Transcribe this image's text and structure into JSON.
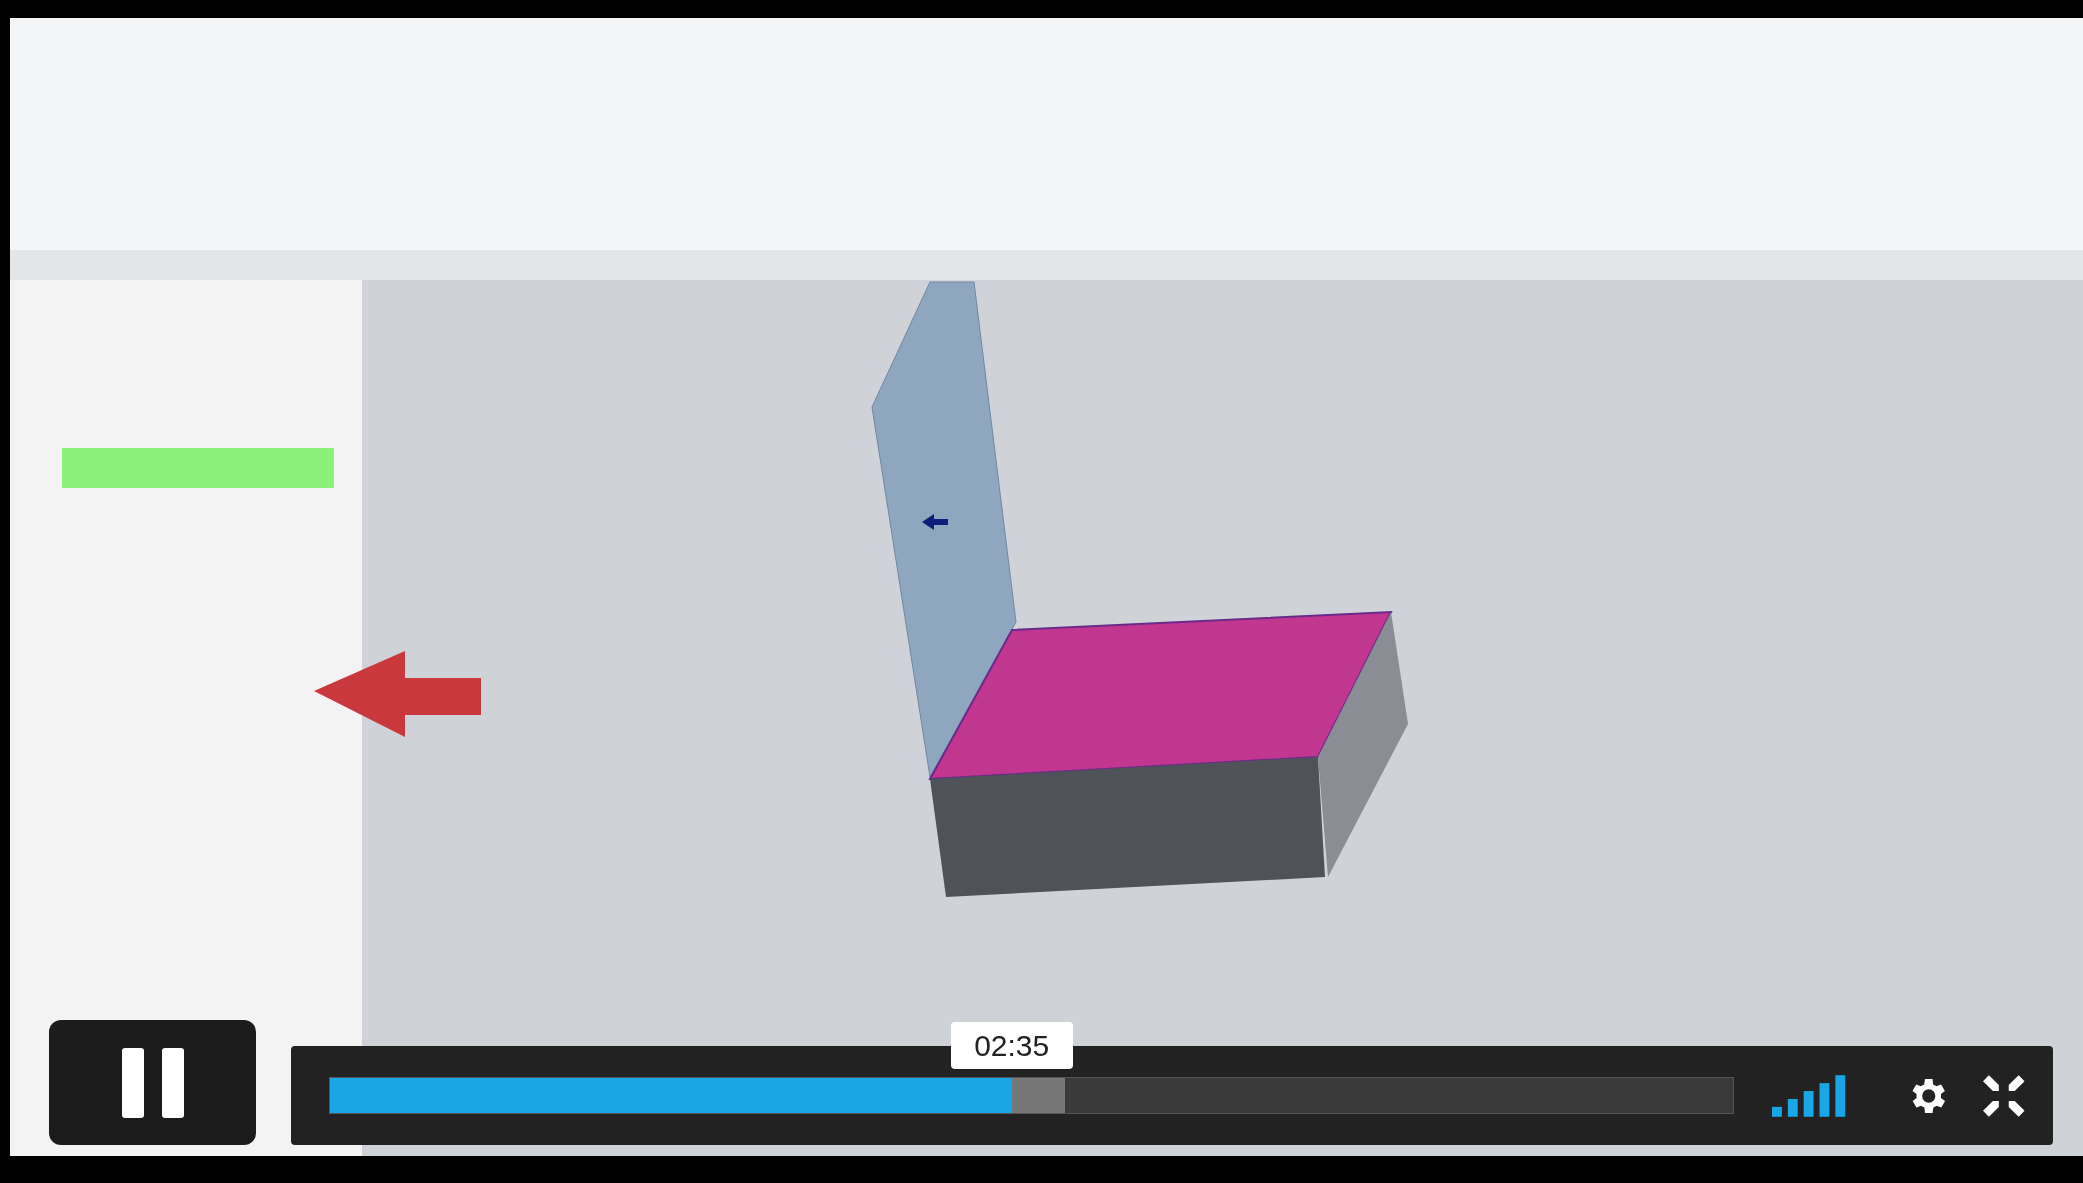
{
  "player": {
    "playing": true,
    "progress": {
      "level": 0.486,
      "time_tooltip": "02:35"
    },
    "buffer": {
      "level": 0.524
    }
  }
}
